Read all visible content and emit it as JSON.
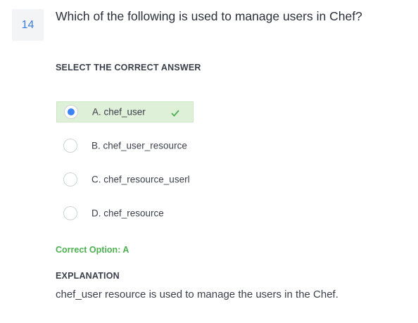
{
  "question": {
    "number": "14",
    "text": "Which of the following is used to manage users in Chef?"
  },
  "select_label": "SELECT THE CORRECT ANSWER",
  "options": [
    {
      "label": "A. chef_user",
      "selected": true,
      "correct": true
    },
    {
      "label": "B. chef_user_resource",
      "selected": false,
      "correct": false
    },
    {
      "label": "C. chef_resource_userl",
      "selected": false,
      "correct": false
    },
    {
      "label": "D. chef_resource",
      "selected": false,
      "correct": false
    }
  ],
  "correct_option": "Correct Option: A",
  "explanation": {
    "label": "EXPLANATION",
    "text": "chef_user resource is used to manage the users in the Chef."
  },
  "colors": {
    "accent": "#3b82f6",
    "correct_bg": "#dff0d8",
    "correct_text": "#4caf50",
    "question_number": "#3b7dd8"
  }
}
